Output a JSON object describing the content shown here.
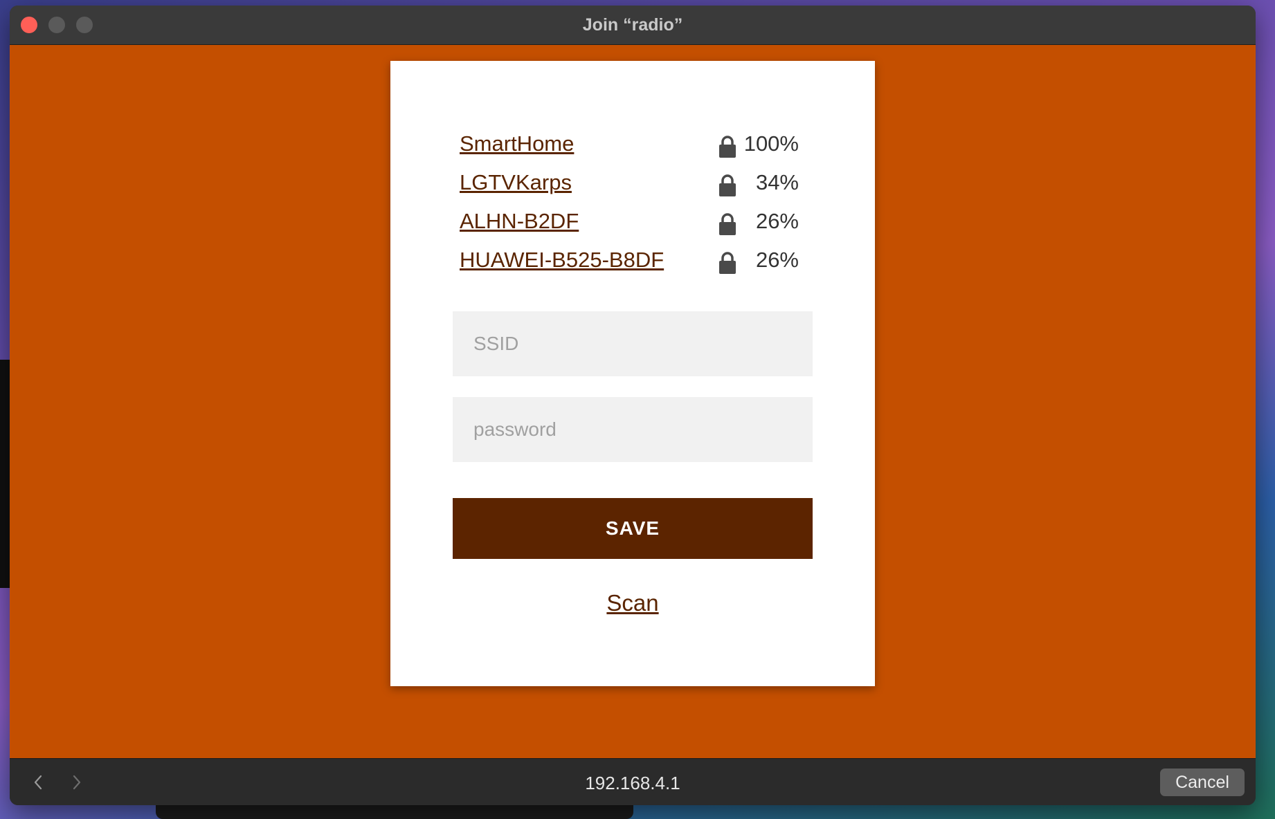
{
  "window": {
    "title": "Join “radio”"
  },
  "networks": [
    {
      "name": "SmartHome",
      "signal": "100%",
      "secured": true,
      "icon": "lock-icon"
    },
    {
      "name": "LGTVKarps",
      "signal": "34%",
      "secured": true,
      "icon": "lock-icon"
    },
    {
      "name": "ALHN-B2DF",
      "signal": "26%",
      "secured": true,
      "icon": "lock-icon"
    },
    {
      "name": "HUAWEI-B525-B8DF",
      "signal": "26%",
      "secured": true,
      "icon": "lock-icon"
    }
  ],
  "form": {
    "ssid_placeholder": "SSID",
    "ssid_value": "",
    "password_placeholder": "password",
    "password_value": "",
    "save_label": "SAVE",
    "scan_label": "Scan"
  },
  "bottombar": {
    "url": "192.168.4.1",
    "cancel_label": "Cancel",
    "back_icon": "chevron-left-icon",
    "forward_icon": "chevron-right-icon"
  },
  "colors": {
    "background": "#c44f00",
    "accent": "#5c2400",
    "card": "#ffffff"
  }
}
